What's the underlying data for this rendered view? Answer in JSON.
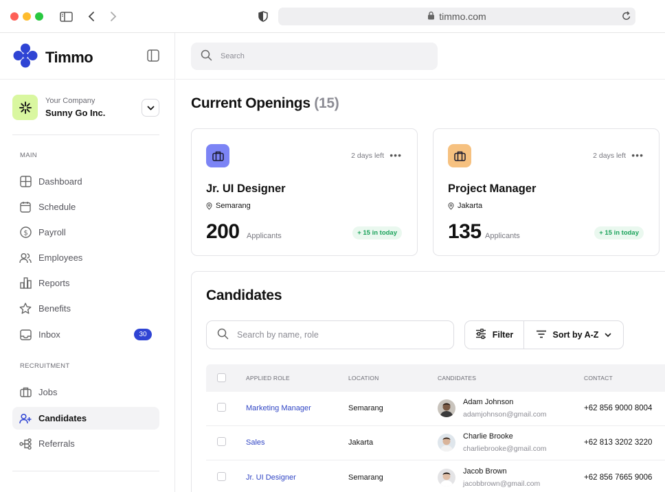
{
  "browser": {
    "url": "timmo.com"
  },
  "brand": {
    "name": "Timmo"
  },
  "company": {
    "label": "Your Company",
    "name": "Sunny Go Inc."
  },
  "sidebar": {
    "main_label": "MAIN",
    "main_items": [
      {
        "label": "Dashboard",
        "icon": "dashboard-icon"
      },
      {
        "label": "Schedule",
        "icon": "calendar-icon"
      },
      {
        "label": "Payroll",
        "icon": "dollar-icon"
      },
      {
        "label": "Employees",
        "icon": "users-icon"
      },
      {
        "label": "Reports",
        "icon": "bar-chart-icon"
      },
      {
        "label": "Benefits",
        "icon": "star-icon"
      },
      {
        "label": "Inbox",
        "icon": "inbox-icon",
        "badge": "30"
      }
    ],
    "recruitment_label": "RECRUITMENT",
    "recruitment_items": [
      {
        "label": "Jobs",
        "icon": "briefcase-icon"
      },
      {
        "label": "Candidates",
        "icon": "user-plus-icon",
        "active": true
      },
      {
        "label": "Referrals",
        "icon": "share-icon"
      }
    ]
  },
  "search": {
    "placeholder": "Search"
  },
  "openings": {
    "title": "Current Openings",
    "count": "(15)",
    "jobs": [
      {
        "title": "Jr. UI Designer",
        "location": "Semarang",
        "days_left": "2 days left",
        "applicants": "200",
        "applicants_label": "Applicants",
        "today": "+ 15 in today",
        "icon_color": "#7c84f5"
      },
      {
        "title": "Project Manager",
        "location": "Jakarta",
        "days_left": "2 days left",
        "applicants": "135",
        "applicants_label": "Applicants",
        "today": "+ 15 in today",
        "icon_color": "#f6c180"
      }
    ]
  },
  "candidates": {
    "title": "Candidates",
    "search_placeholder": "Search by name, role",
    "filter_label": "Filter",
    "sort_label": "Sort by A-Z",
    "columns": [
      "APPLIED ROLE",
      "LOCATION",
      "CANDIDATES",
      "CONTACT"
    ],
    "rows": [
      {
        "role": "Marketing Manager",
        "location": "Semarang",
        "name": "Adam Johnson",
        "email": "adamjohnson@gmail.com",
        "contact": "+62 856 9000 8004"
      },
      {
        "role": "Sales",
        "location": "Jakarta",
        "name": "Charlie Brooke",
        "email": "charliebrooke@gmail.com",
        "contact": "+62 813 3202 3220"
      },
      {
        "role": "Jr. UI Designer",
        "location": "Semarang",
        "name": "Jacob Brown",
        "email": "jacobbrown@gmail.com",
        "contact": "+62 856 7665 9006"
      }
    ]
  }
}
